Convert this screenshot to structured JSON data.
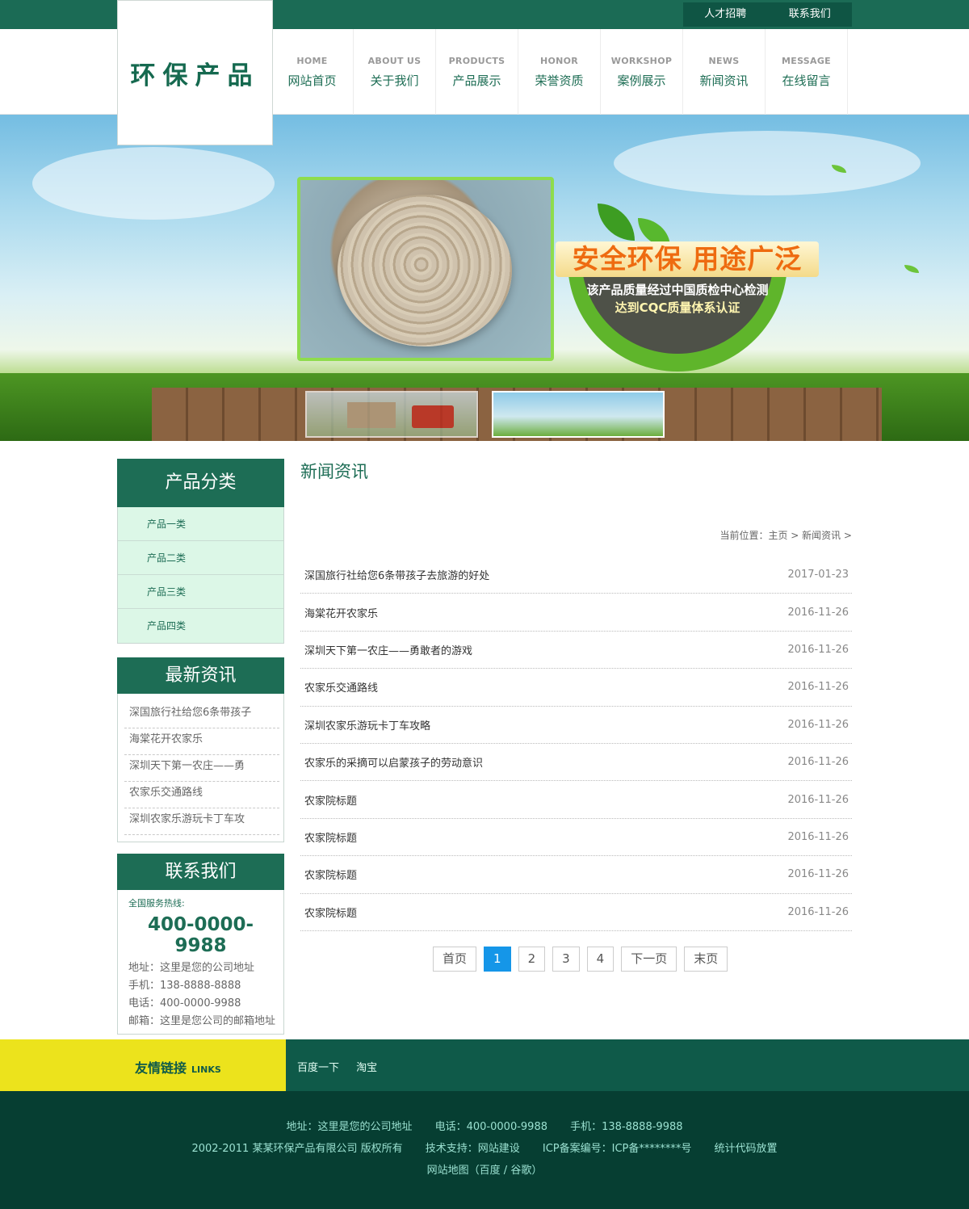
{
  "top_links": [
    "人才招聘",
    "联系我们"
  ],
  "logo": "环保产品",
  "nav": [
    {
      "en": "HOME",
      "cn": "网站首页"
    },
    {
      "en": "ABOUT US",
      "cn": "关于我们"
    },
    {
      "en": "PRODUCTS",
      "cn": "产品展示"
    },
    {
      "en": "HONOR",
      "cn": "荣誉资质"
    },
    {
      "en": "WORKSHOP",
      "cn": "案例展示"
    },
    {
      "en": "NEWS",
      "cn": "新闻资讯"
    },
    {
      "en": "MESSAGE",
      "cn": "在线留言"
    }
  ],
  "banner": {
    "headline": "安全环保 用途广泛",
    "line1": "该产品质量经过中国质检中心检测",
    "line2": "达到CQC质量体系认证"
  },
  "sidebar": {
    "category_title": "产品分类",
    "categories": [
      "产品一类",
      "产品二类",
      "产品三类",
      "产品四类"
    ],
    "news_title": "最新资讯",
    "news": [
      "深国旅行社给您6条带孩子",
      "海棠花开农家乐",
      "深圳天下第一农庄——勇",
      "农家乐交通路线",
      "深圳农家乐游玩卡丁车攻"
    ],
    "contact_title": "联系我们",
    "hotline_label": "全国服务热线:",
    "hotline": "400-0000-9988",
    "address": "地址：这里是您的公司地址",
    "mobile": "手机：138-8888-8888",
    "phone": "电话：400-0000-9988",
    "email": "邮箱：这里是您公司的邮箱地址"
  },
  "main": {
    "title": "新闻资讯",
    "breadcrumb": "当前位置：主页 > 新闻资讯 >",
    "articles": [
      {
        "title": "深国旅行社给您6条带孩子去旅游的好处",
        "date": "2017-01-23"
      },
      {
        "title": "海棠花开农家乐",
        "date": "2016-11-26"
      },
      {
        "title": "深圳天下第一农庄——勇敢者的游戏",
        "date": "2016-11-26"
      },
      {
        "title": "农家乐交通路线",
        "date": "2016-11-26"
      },
      {
        "title": "深圳农家乐游玩卡丁车攻略",
        "date": "2016-11-26"
      },
      {
        "title": "农家乐的采摘可以启蒙孩子的劳动意识",
        "date": "2016-11-26"
      },
      {
        "title": "农家院标题",
        "date": "2016-11-26"
      },
      {
        "title": "农家院标题",
        "date": "2016-11-26"
      },
      {
        "title": "农家院标题",
        "date": "2016-11-26"
      },
      {
        "title": "农家院标题",
        "date": "2016-11-26"
      }
    ],
    "pager": {
      "first": "首页",
      "pages": [
        "1",
        "2",
        "3",
        "4"
      ],
      "current": "1",
      "next": "下一页",
      "last": "末页"
    }
  },
  "links": {
    "title": "友情链接",
    "title_en": "LINKS",
    "items": [
      "百度一下",
      "淘宝"
    ]
  },
  "footer": {
    "line1": [
      "地址：这里是您的公司地址",
      "电话：400-0000-9988",
      "手机：138-8888-9988"
    ],
    "line2": [
      "2002-2011 某某环保产品有限公司 版权所有",
      "技术支持：网站建设",
      "ICP备案编号：ICP备********号",
      "统计代码放置"
    ],
    "line3": "网站地图（百度 / 谷歌）"
  },
  "colors": {
    "primary": "#1d6d55",
    "accent_yellow": "#ece31c",
    "footer_bg": "#063e32",
    "pager_active": "#1596e8"
  }
}
